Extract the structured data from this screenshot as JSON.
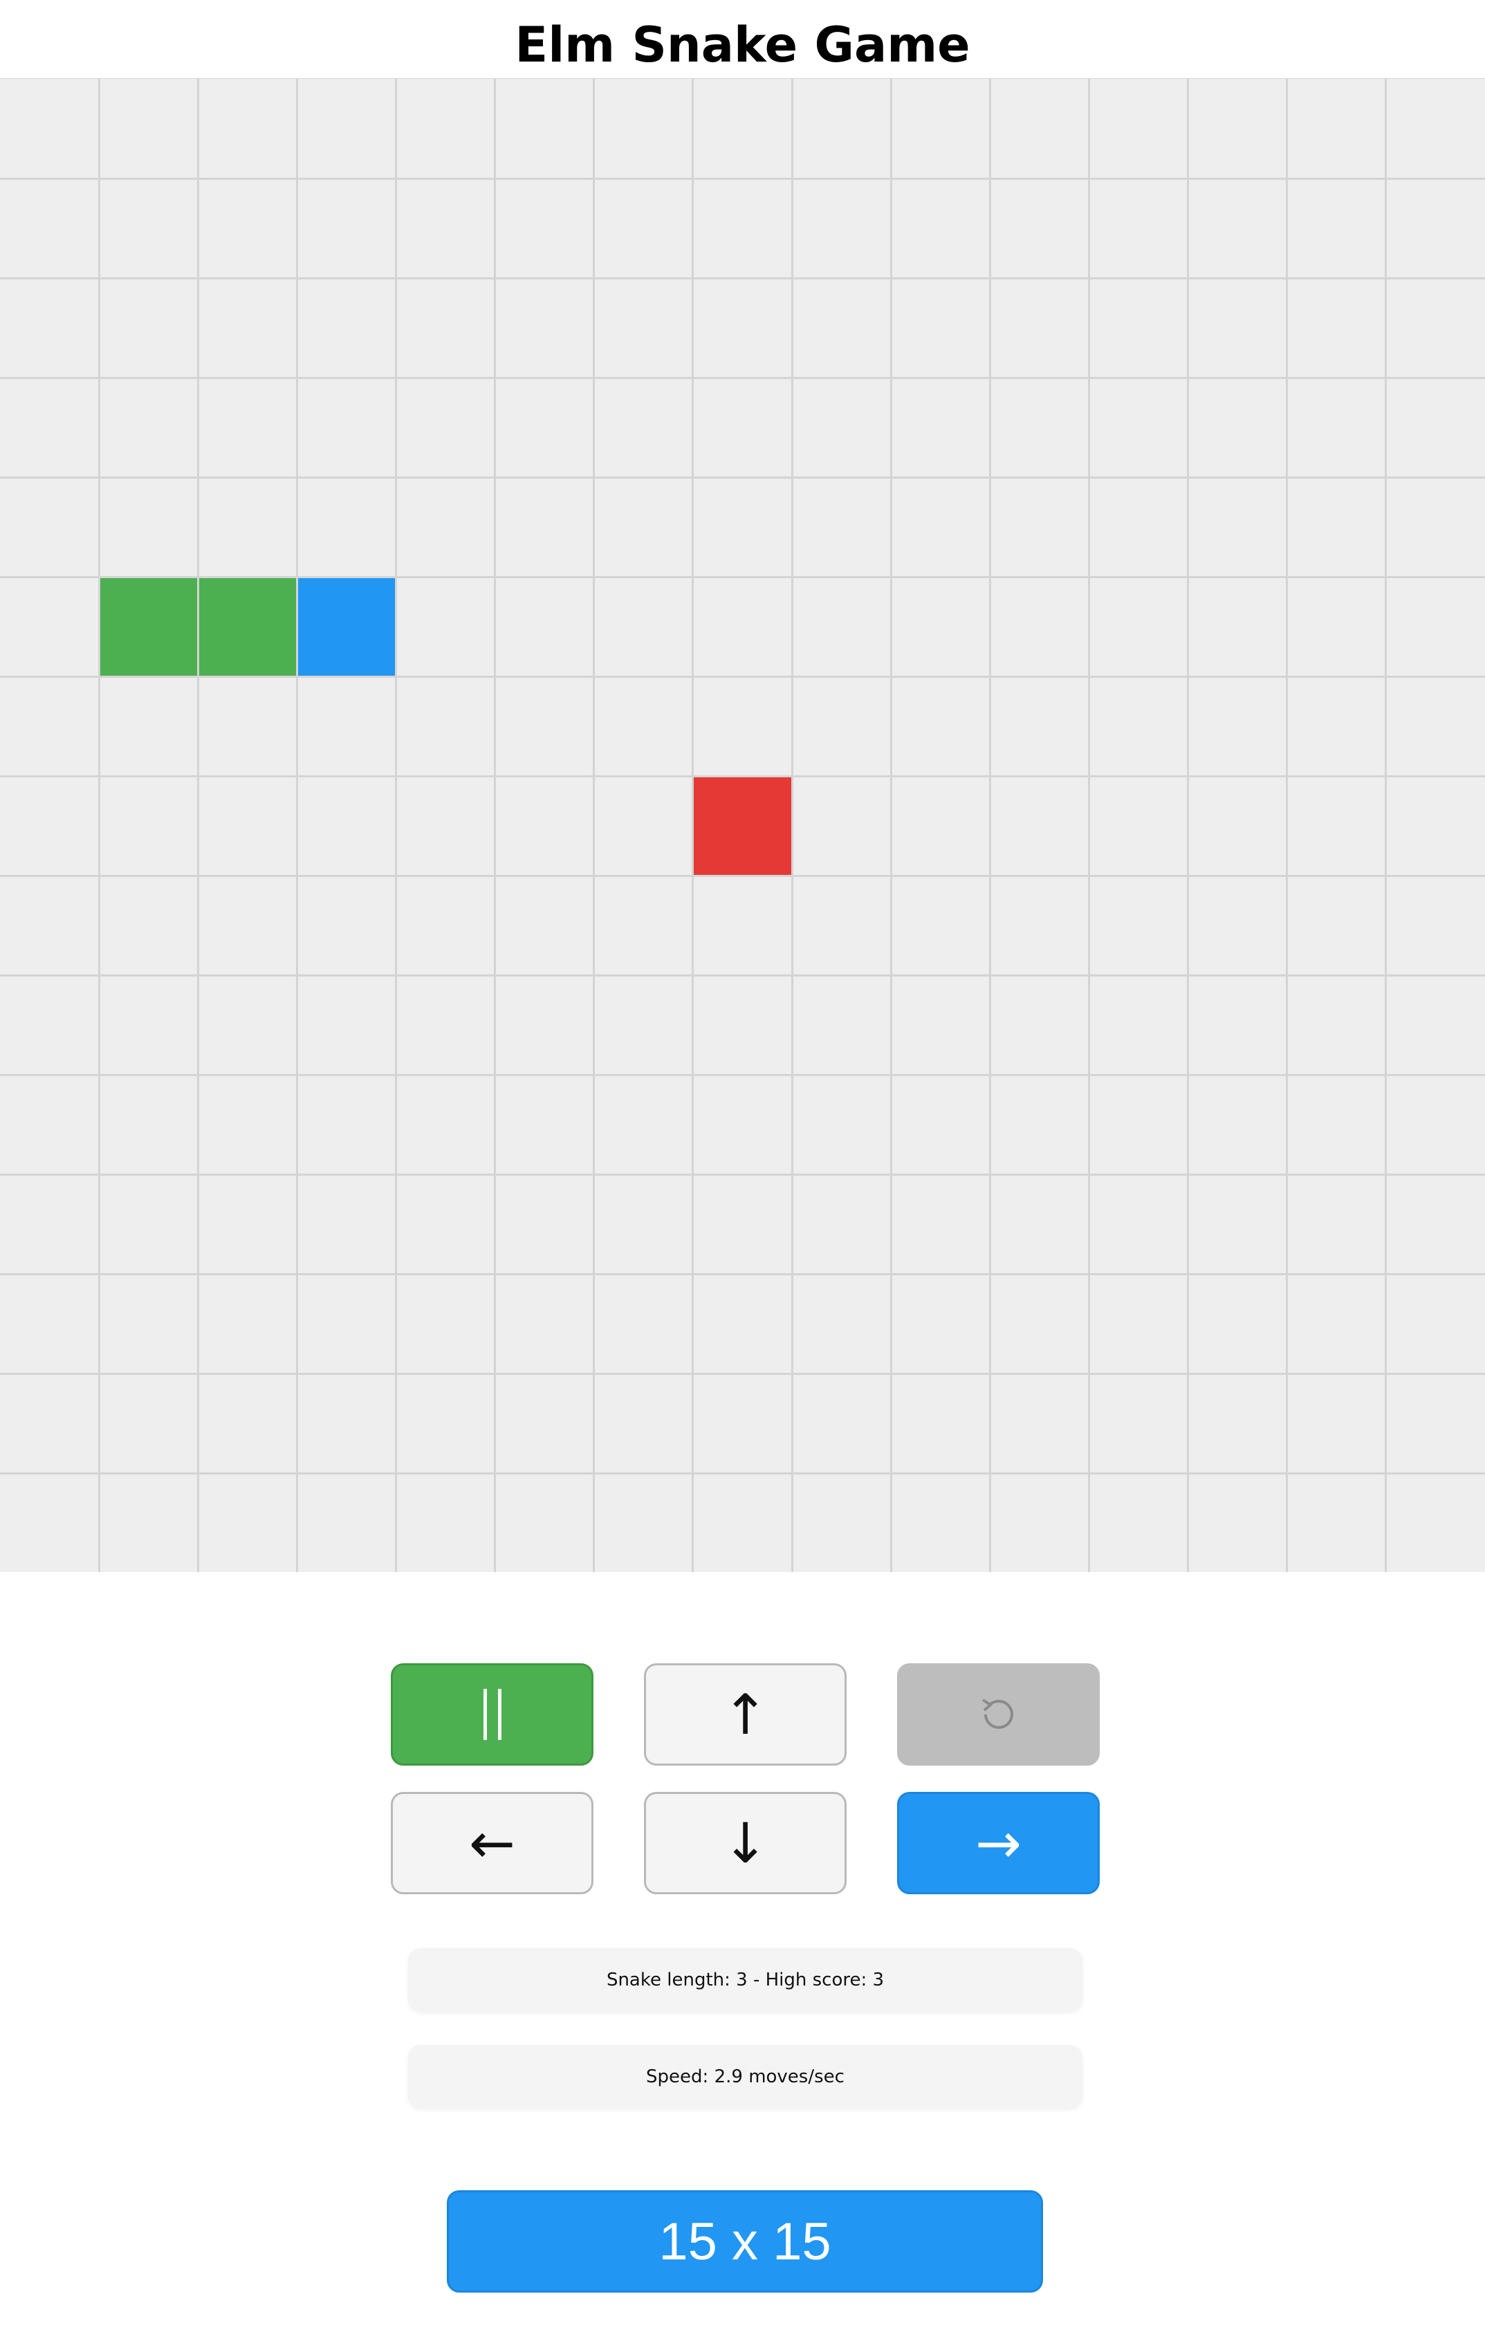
{
  "title": "Elm Snake Game",
  "game": {
    "grid_cols": 15,
    "grid_rows": 15,
    "snake": [
      {
        "col": 1,
        "row": 5,
        "part": "body"
      },
      {
        "col": 2,
        "row": 5,
        "part": "body"
      },
      {
        "col": 3,
        "row": 5,
        "part": "head"
      }
    ],
    "food": {
      "col": 7,
      "row": 7
    },
    "colors": {
      "board": "#eeeeee",
      "gridline": "#d4d4d4",
      "snake_body": "#4caf50",
      "snake_head": "#2196f3",
      "food": "#e53935"
    }
  },
  "controls": {
    "pause_icon": "pause-icon",
    "up_label": "↑",
    "restart_icon": "restart-icon",
    "left_label": "←",
    "down_label": "↓",
    "right_label": "→"
  },
  "status": {
    "length_text": "Snake length: 3 - High score: 3",
    "speed_text": "Speed: 2.9 moves/sec"
  },
  "size_button": {
    "label": "15 x 15"
  }
}
